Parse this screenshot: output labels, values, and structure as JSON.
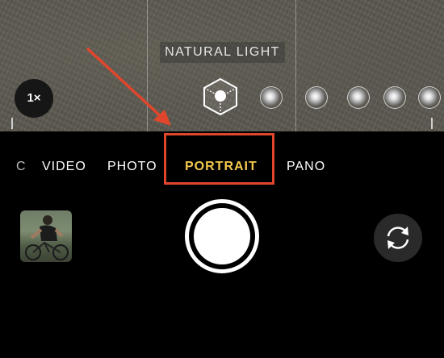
{
  "viewfinder": {
    "lighting_label": "NATURAL LIGHT",
    "zoom_label": "1×",
    "lighting_options": [
      {
        "name": "natural-light",
        "selected": true
      },
      {
        "name": "studio-light",
        "selected": false
      },
      {
        "name": "contour-light",
        "selected": false
      },
      {
        "name": "stage-light",
        "selected": false
      },
      {
        "name": "stage-light-mono",
        "selected": false
      },
      {
        "name": "high-key-light-mono",
        "selected": false
      }
    ]
  },
  "modes": {
    "partial_left": "C",
    "items": [
      "VIDEO",
      "PHOTO",
      "PORTRAIT",
      "PANO"
    ],
    "active": "PORTRAIT"
  },
  "controls": {
    "thumbnail": "last-photo-thumbnail",
    "shutter": "shutter-button",
    "flip": "camera-flip-icon"
  },
  "colors": {
    "active_mode": "#f2c94c",
    "annotation": "#e0462c",
    "background": "#000000"
  }
}
